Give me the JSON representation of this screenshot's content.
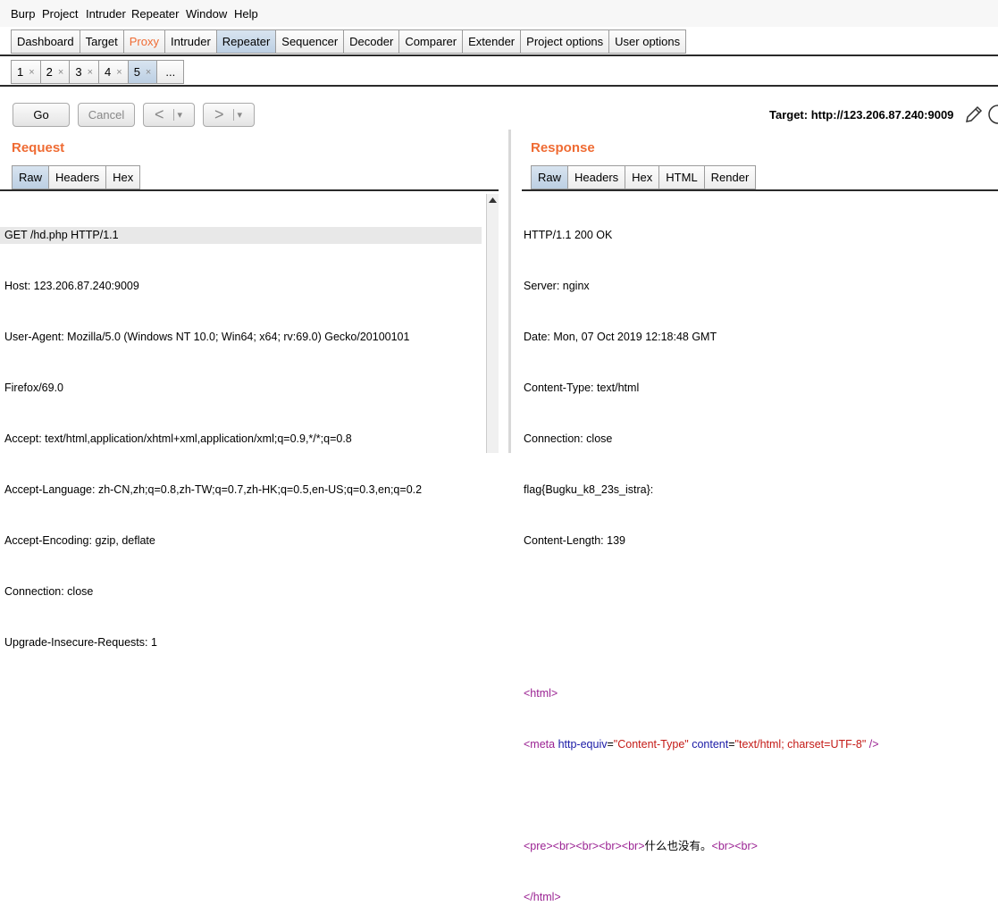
{
  "menu": [
    "Burp",
    "Project",
    "Intruder",
    "Repeater",
    "Window",
    "Help"
  ],
  "main_tabs": [
    "Dashboard",
    "Target",
    "Proxy",
    "Intruder",
    "Repeater",
    "Sequencer",
    "Decoder",
    "Comparer",
    "Extender",
    "Project options",
    "User options"
  ],
  "repeater_tabs": [
    "1",
    "2",
    "3",
    "4",
    "5",
    "..."
  ],
  "tab_close": "×",
  "toolbar": {
    "go": "Go",
    "cancel": "Cancel",
    "back": "<",
    "forward": ">",
    "dropdown": "▾"
  },
  "target_label": "Target: http://123.206.87.240:9009",
  "request": {
    "title": "Request",
    "tabs": [
      "Raw",
      "Headers",
      "Hex"
    ],
    "lines": [
      "GET /hd.php HTTP/1.1",
      "Host: 123.206.87.240:9009",
      "User-Agent: Mozilla/5.0 (Windows NT 10.0; Win64; x64; rv:69.0) Gecko/20100101",
      "Firefox/69.0",
      "Accept: text/html,application/xhtml+xml,application/xml;q=0.9,*/*;q=0.8",
      "Accept-Language: zh-CN,zh;q=0.8,zh-TW;q=0.7,zh-HK;q=0.5,en-US;q=0.3,en;q=0.2",
      "Accept-Encoding: gzip, deflate",
      "Connection: close",
      "Upgrade-Insecure-Requests: 1"
    ]
  },
  "response": {
    "title": "Response",
    "tabs": [
      "Raw",
      "Headers",
      "Hex",
      "HTML",
      "Render"
    ],
    "lines": [
      "HTTP/1.1 200 OK",
      "Server: nginx",
      "Date: Mon, 07 Oct 2019 12:18:48 GMT",
      "Content-Type: text/html",
      "Connection: close",
      "flag{Bugku_k8_23s_istra}:",
      "Content-Length: 139"
    ],
    "html_open": "<html>",
    "meta": {
      "open": "<meta",
      "attr1": "http-equiv",
      "val1": "\"Content-Type\"",
      "attr2": "content",
      "val2": "\"text/html; charset=UTF-8\"",
      "close": "/>"
    },
    "pre_line": {
      "tags_before": "<pre><br><br><br><br>",
      "text": "什么也没有。",
      "tags_after": "<br><br>"
    },
    "html_close": "</html>"
  }
}
